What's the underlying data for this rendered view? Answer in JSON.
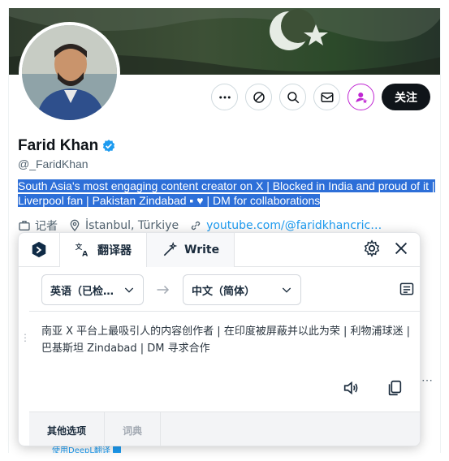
{
  "profile": {
    "name": "Farid Khan",
    "handle": "@_FaridKhan",
    "bio": "South Asia's most engaging content creator on X | Blocked in India and proud of it | Liverpool fan | Pakistan Zindabad",
    "bio_end": "| DM for collaborations",
    "role": "记者",
    "location": "İstanbul, Türkiye",
    "website": "youtube.com/@faridkhancric…",
    "follow_label": "关注"
  },
  "translator": {
    "tab_translate": "翻译器",
    "tab_write": "Write",
    "source_lang": "英语（已检…",
    "target_lang": "中文（简体）",
    "translated_text": "南亚 X 平台上最吸引人的内容创作者 | 在印度被屏蔽并以此为荣 | 利物浦球迷 | 巴基斯坦 Zindabad | DM 寻求合作",
    "footer_more": "其他选项",
    "footer_dict": "词典"
  },
  "below": {
    "deepl_text": "使用DeepL翻译"
  },
  "colors": {
    "accent": "#1d9bf0",
    "highlight": "#2d6fd8",
    "follow_bg": "#0f1419",
    "subscribe": "#c026d3"
  }
}
